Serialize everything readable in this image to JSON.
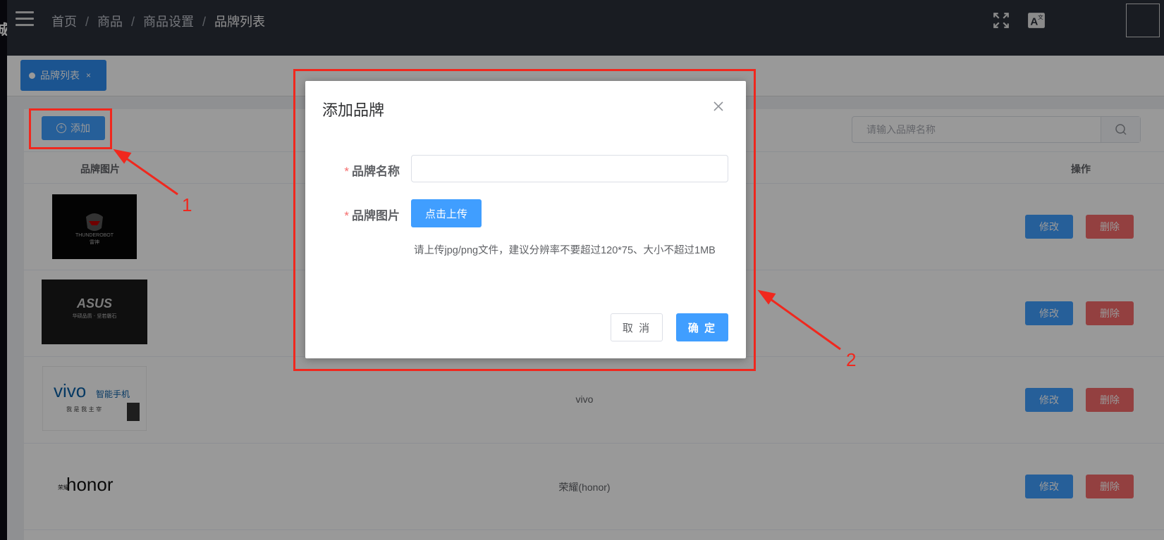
{
  "header": {
    "logo_fragment": "城",
    "breadcrumb": [
      "首页",
      "商品",
      "商品设置",
      "品牌列表"
    ],
    "breadcrumb_separator": "/",
    "icons": [
      "menu-icon",
      "fullscreen-icon",
      "translate-icon",
      "avatar-image"
    ]
  },
  "tags": [
    {
      "label": "品牌列表",
      "close": "×",
      "active": true
    }
  ],
  "toolbar": {
    "add_label": "添加",
    "search_placeholder": "请输入品牌名称"
  },
  "table": {
    "headers": {
      "image": "品牌图片",
      "actions": "操作"
    },
    "rows": [
      {
        "logo": "thunderobot",
        "logo_text": "THUNDEROBOT",
        "logo_subtext": "雷神",
        "name": ""
      },
      {
        "logo": "asus",
        "logo_text": "ASUS",
        "logo_subtext": "华硕品质 · 坚若磐石",
        "name": ""
      },
      {
        "logo": "vivo",
        "logo_text": "vivo",
        "logo_subtext": "智能手机",
        "logo_slogan": "我 是 我 主 宰",
        "name": "vivo"
      },
      {
        "logo": "honor",
        "logo_text": "honor",
        "logo_subtext": "荣耀",
        "name": "荣耀(honor)"
      }
    ],
    "edit_label": "修改",
    "delete_label": "删除"
  },
  "dialog": {
    "title": "添加品牌",
    "required_mark": "*",
    "name_label": "品牌名称",
    "name_value": "",
    "image_label": "品牌图片",
    "upload_label": "点击上传",
    "upload_tip": "请上传jpg/png文件，建议分辨率不要超过120*75、大小不超过1MB",
    "cancel_label": "取 消",
    "confirm_label": "确 定"
  },
  "annotations": [
    {
      "number": "1",
      "target": "add-button"
    },
    {
      "number": "2",
      "target": "add-brand-dialog"
    }
  ],
  "colors": {
    "primary": "#409eff",
    "danger": "#f56c6c",
    "navbar": "#2b2f3a",
    "annotation": "#f0281e"
  }
}
